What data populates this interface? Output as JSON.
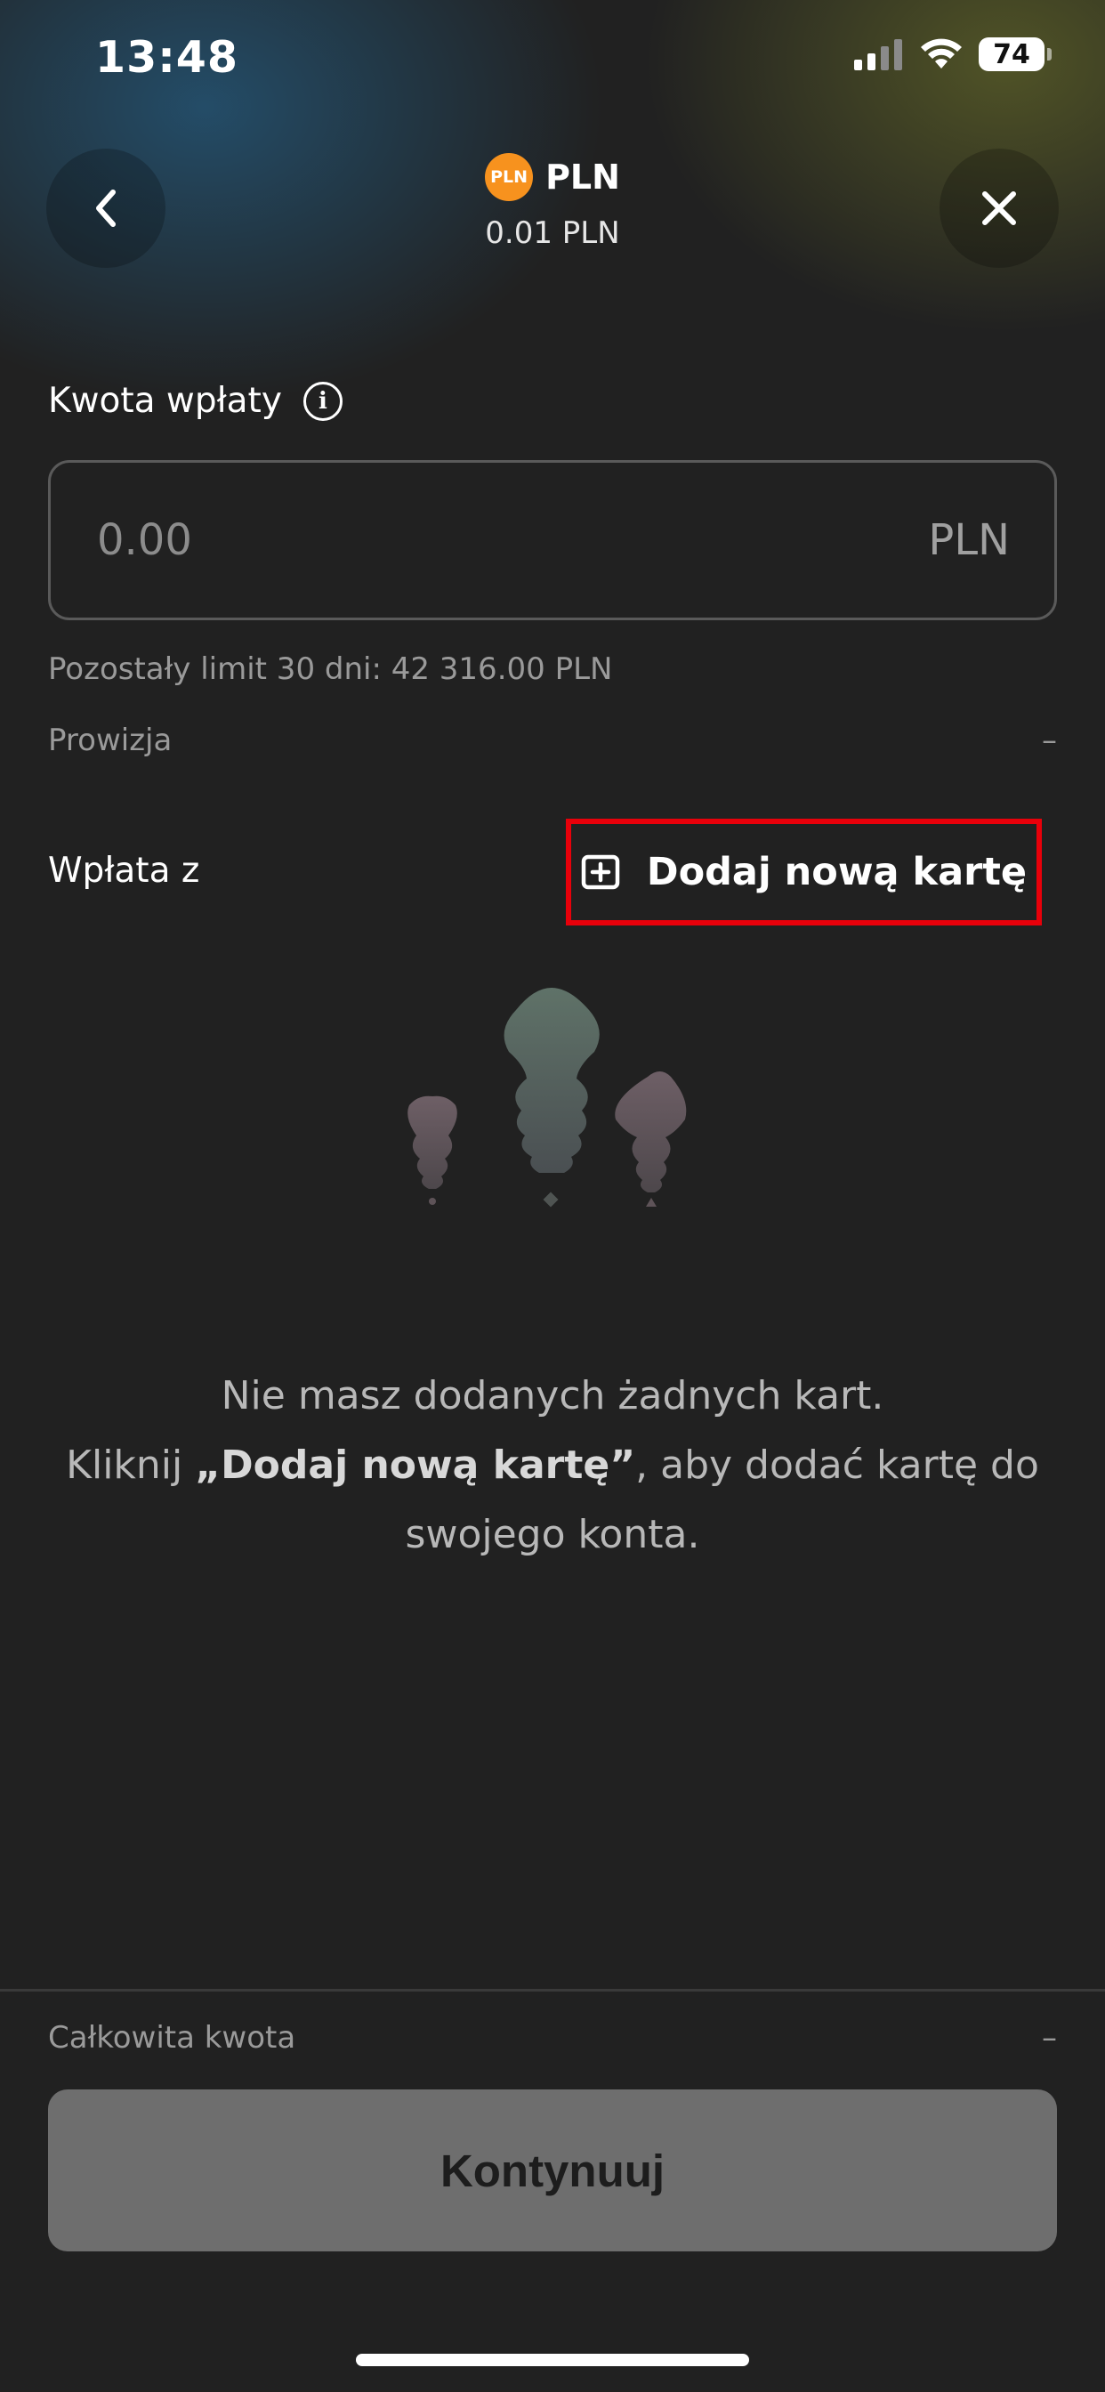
{
  "status_bar": {
    "time": "13:48",
    "battery": "74"
  },
  "header": {
    "currency_badge": "PLN",
    "currency_code": "PLN",
    "balance": "0.01 PLN"
  },
  "form": {
    "amount_label": "Kwota wpłaty",
    "amount_placeholder": "0.00",
    "amount_unit": "PLN",
    "limit_text": "Pozostały limit 30 dni: 42 316.00 PLN",
    "fee_label": "Prowizja",
    "fee_value": "–",
    "source_label": "Wpłata z",
    "add_card_label": "Dodaj nową kartę"
  },
  "empty_state": {
    "line1": "Nie masz dodanych żadnych kart.",
    "line2_prefix": "Kliknij ",
    "line2_bold": "„Dodaj nową kartę”",
    "line2_suffix": ", aby dodać kartę do",
    "line3": "swojego konta."
  },
  "footer": {
    "total_label": "Całkowita kwota",
    "total_value": "–",
    "continue_label": "Kontynuuj"
  },
  "colors": {
    "background": "#212121",
    "highlight_border": "#e8000a",
    "currency_badge": "#f7921e",
    "button_disabled": "#6e6e6e"
  }
}
